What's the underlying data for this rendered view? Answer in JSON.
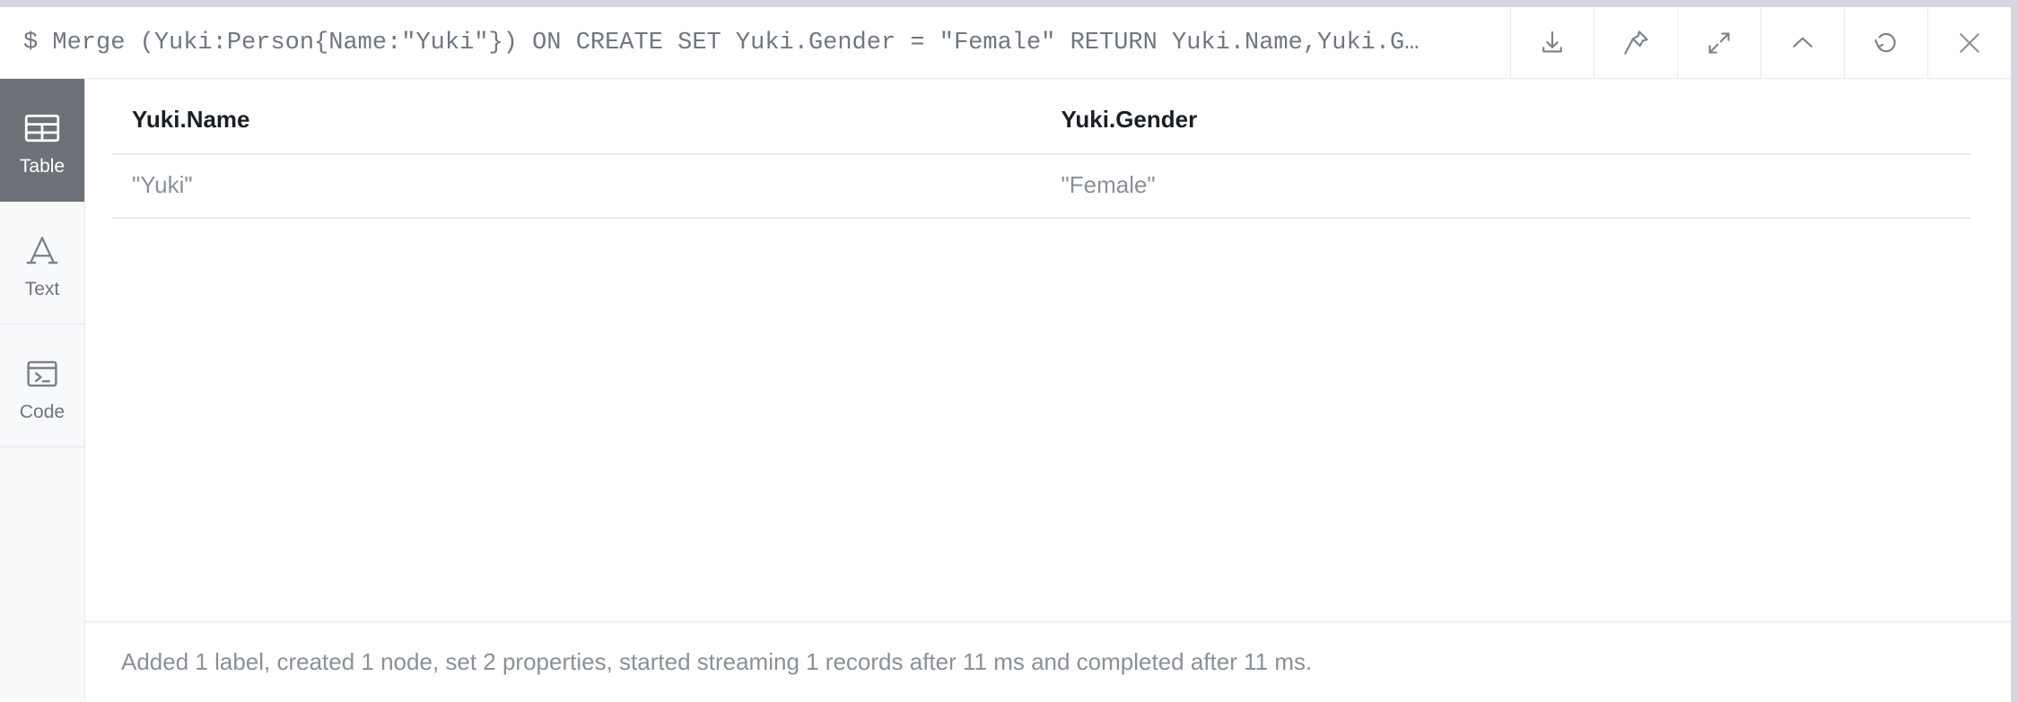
{
  "query": {
    "prompt": "$",
    "text": "$ Merge (Yuki:Person{Name:\"Yuki\"}) ON CREATE SET Yuki.Gender = \"Female\" RETURN Yuki.Name,Yuki.G…"
  },
  "toolbar": {
    "buttons": [
      {
        "name": "download-icon",
        "label": "Download"
      },
      {
        "name": "pin-icon",
        "label": "Pin"
      },
      {
        "name": "expand-icon",
        "label": "Expand"
      },
      {
        "name": "chevron-up-icon",
        "label": "Collapse"
      },
      {
        "name": "refresh-icon",
        "label": "Rerun"
      },
      {
        "name": "close-icon",
        "label": "Close"
      }
    ]
  },
  "sidebar": {
    "items": [
      {
        "label": "Table",
        "icon": "table-icon",
        "active": true
      },
      {
        "label": "Text",
        "icon": "text-icon",
        "active": false
      },
      {
        "label": "Code",
        "icon": "code-icon",
        "active": false
      }
    ]
  },
  "result_table": {
    "columns": [
      "Yuki.Name",
      "Yuki.Gender"
    ],
    "rows": [
      [
        "\"Yuki\"",
        "\"Female\""
      ]
    ]
  },
  "status": {
    "message": "Added 1 label, created 1 node, set 2 properties, started streaming 1 records after 11 ms and completed after 11 ms."
  },
  "colors": {
    "page_background": "#d4d7dd",
    "frame_background": "#ffffff",
    "sidebar_background": "#f8f9fb",
    "sidebar_active_background": "#6d7279",
    "query_text": "#717780",
    "header_text": "#1a1f24",
    "value_text": "#8a9097",
    "divider": "#e6e9ef"
  }
}
